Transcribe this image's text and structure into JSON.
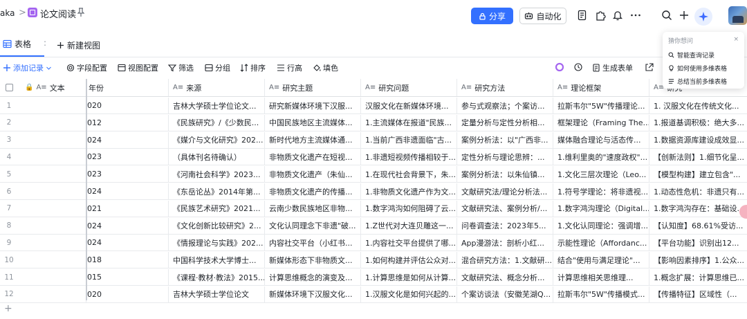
{
  "topbar": {
    "workspace": "aka",
    "separator": ">",
    "doc_title": "论文阅读",
    "share_label": "分享",
    "automation_label": "自动化"
  },
  "tabs": {
    "active_label": "表格",
    "more": ":",
    "new_view_label": "新建视图"
  },
  "toolbar": {
    "add_record": "添加记录",
    "field_config": "字段配置",
    "view_config": "视图配置",
    "filter": "筛选",
    "group": "分组",
    "sort": "排序",
    "row_height": "行高",
    "fill": "填色",
    "generate_form": "生成表单"
  },
  "popover": {
    "title": "猜你想问",
    "close": "×",
    "items": [
      "智能查询记录",
      "如何使用多维表格",
      "总结当前多维表格"
    ]
  },
  "grid": {
    "headers": [
      "文本",
      "年份",
      "来源",
      "研究主题",
      "研究问题",
      "研究方法",
      "理论框架",
      "研究"
    ],
    "rows": [
      {
        "num": "1",
        "text": "",
        "year": "020",
        "source": "吉林大学硕士学位论文...",
        "topic": "研究新媒体环境下汉服...",
        "question": "汉服文化在新媒体环境...",
        "method": "参与式观察法；个案访...",
        "theory": "拉斯韦尔\"5W\"传播理论...",
        "extra": "1. 汉服文化在传统文化..."
      },
      {
        "num": "2",
        "text": "",
        "year": "012",
        "source": "《民族研究》/《少数民...",
        "topic": "中国民族地区主流媒体...",
        "question": "1.主流媒体在报道\"民族...",
        "method": "定量分析与定性分析相...",
        "theory": "框架理论（Framing The...",
        "extra": "1.报道基调积极：绝大多..."
      },
      {
        "num": "3",
        "text": "",
        "year": "024",
        "source": "《媒介与文化研究》202...",
        "topic": "新时代地方主流媒体通...",
        "question": "1.当前广西非遗面临\"古...",
        "method": "案例分析法：以\"广西非...",
        "theory": "媒体融合理论与活态传...",
        "extra": "1.数据资源库建设成效显..."
      },
      {
        "num": "4",
        "text": "",
        "year": "023",
        "source": "（具体刊名待确认）",
        "topic": "非物质文化遗产在短视...",
        "question": "1.非遗短视频传播相较于...",
        "method": "定性分析与理论思辨：...",
        "theory": "1.维利里奥的\"速度政权\"...",
        "extra": "【创新法则】1.细节化呈..."
      },
      {
        "num": "5",
        "text": "",
        "year": "023",
        "source": "《河南社会科学》2023...",
        "topic": "非物质文化遗产（朱仙...",
        "question": "1.在现代社会背景下，朱...",
        "method": "案例分析法：以朱仙镇...",
        "theory": "1.文化三层次理论（Leo...",
        "extra": "【模型构建】建立包含\"..."
      },
      {
        "num": "6",
        "text": "",
        "year": "024",
        "source": "《东岳论丛》2014年第...",
        "topic": "非物质文化遗产的传播...",
        "question": "1.非物质文化遗产作为文...",
        "method": "文献研究法/理论分析法...",
        "theory": "1.符号学理论：将非遗视...",
        "extra": "1.动态性危机：非遗只有..."
      },
      {
        "num": "7",
        "text": "",
        "year": "021",
        "source": "《民族艺术研究》2021...",
        "topic": "云南少数民族地区非物...",
        "question": "1.数字鸿沟如何阻碍了云...",
        "method": "文献研究法、案例分析/...",
        "theory": "1.数字鸿沟理论（Digital...",
        "extra": "1.数字鸿沟存在：基础设..."
      },
      {
        "num": "8",
        "text": "",
        "year": "024",
        "source": "《文化创新比较研究》2...",
        "topic": "文化认同理念下非遗\"破...",
        "question": "1.Z世代对大连贝雕这一...",
        "method": "问卷调查法：2023年5...",
        "theory": "1.文化认同理论：强调增...",
        "extra": "【认知度】68.61%受访..."
      },
      {
        "num": "9",
        "text": "",
        "year": "024",
        "source": "《情报理论与实践》202...",
        "topic": "内容社交平台（小红书...",
        "question": "1.内容社交平台提供了哪...",
        "method": "App漫游法：剖析小红...",
        "theory": "示能性理论（Affordanc...",
        "extra": "【平台功能】识别出12..."
      },
      {
        "num": "10",
        "text": "",
        "year": "018",
        "source": "中国科学技术大学博士...",
        "topic": "新媒体形态下非物质文...",
        "question": "1.如何构建并评估公众对...",
        "method": "混合研究方法：1.文献研...",
        "theory": "结合\"使用与满足理论\"...",
        "extra": "【影响因素排序】1.公众..."
      },
      {
        "num": "11",
        "text": "",
        "year": "015",
        "source": "《课程·教材·教法》2015...",
        "topic": "计算思维概念的演变及...",
        "question": "1.计算思维是如何从计算...",
        "method": "文献研究法、概念分析...",
        "theory": "计算思维相关思维理...",
        "extra": "1.概念扩展：计算思维已..."
      },
      {
        "num": "12",
        "text": "",
        "year": "020",
        "source": "吉林大学硕士学位论文",
        "topic": "新媒体环境下汉服文化...",
        "question": "1.汉服文化是如何兴起的...",
        "method": "个案访谈法（安徽芜湖Q...",
        "theory": "拉斯韦尔\"5W\"传播模式...",
        "extra": "【传播特征】区域性（..."
      }
    ],
    "add_row": "+"
  }
}
